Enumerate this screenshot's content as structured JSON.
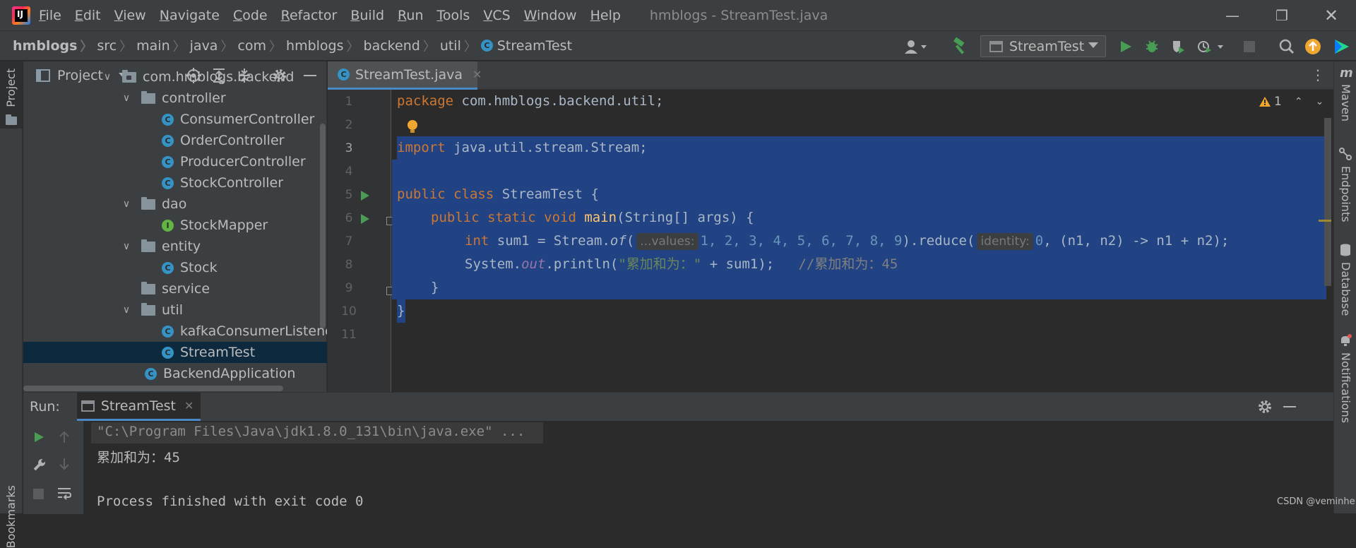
{
  "window": {
    "title": "hmblogs - StreamTest.java",
    "logo_text": "IJ"
  },
  "menu": [
    "File",
    "Edit",
    "View",
    "Navigate",
    "Code",
    "Refactor",
    "Build",
    "Run",
    "Tools",
    "VCS",
    "Window",
    "Help"
  ],
  "breadcrumb": [
    "hmblogs",
    "src",
    "main",
    "java",
    "com",
    "hmblogs",
    "backend",
    "util",
    "StreamTest"
  ],
  "run_config": {
    "label": "StreamTest"
  },
  "left_strip": {
    "project_tab": "Project",
    "bookmarks_tab": "Bookmarks"
  },
  "right_strip": {
    "maven": "Maven",
    "endpoints": "Endpoints",
    "database": "Database",
    "notifications": "Notifications"
  },
  "project_panel": {
    "title": "Project",
    "tree": [
      {
        "label": "com.hmblogs.backend",
        "type": "package",
        "depth": 0,
        "expanded": true
      },
      {
        "label": "controller",
        "type": "folder",
        "depth": 1,
        "expanded": true
      },
      {
        "label": "ConsumerController",
        "type": "class",
        "depth": 2
      },
      {
        "label": "OrderController",
        "type": "class",
        "depth": 2
      },
      {
        "label": "ProducerController",
        "type": "class",
        "depth": 2
      },
      {
        "label": "StockController",
        "type": "class",
        "depth": 2
      },
      {
        "label": "dao",
        "type": "folder",
        "depth": 1,
        "expanded": true
      },
      {
        "label": "StockMapper",
        "type": "interface",
        "depth": 2
      },
      {
        "label": "entity",
        "type": "folder",
        "depth": 1,
        "expanded": true
      },
      {
        "label": "Stock",
        "type": "class",
        "depth": 2
      },
      {
        "label": "service",
        "type": "folder",
        "depth": 1,
        "expanded": false
      },
      {
        "label": "util",
        "type": "folder",
        "depth": 1,
        "expanded": true
      },
      {
        "label": "kafkaConsumerListenerl",
        "type": "class",
        "depth": 2
      },
      {
        "label": "StreamTest",
        "type": "class",
        "depth": 2,
        "selected": true
      },
      {
        "label": "BackendApplication",
        "type": "class",
        "depth": 1
      }
    ]
  },
  "editor": {
    "tab_label": "StreamTest.java",
    "warning_count": "1",
    "line_numbers": [
      "1",
      "2",
      "3",
      "4",
      "5",
      "6",
      "7",
      "8",
      "9",
      "10",
      "11"
    ],
    "code": {
      "l1_kw": "package",
      "l1_rest": " com.hmblogs.backend.util;",
      "l3_kw": "import",
      "l3_rest": " java.util.stream.Stream;",
      "l5_kw": "public class",
      "l5_rest": " StreamTest {",
      "l6_kw": "public static void",
      "l6_fn": "main",
      "l6_rest": "(String[] args) {",
      "l7_kw": "int",
      "l7_a": " sum1 = Stream.",
      "l7_of": "of",
      "l7_hint1": "...values:",
      "l7_nums": "1, 2, 3, 4, 5, 6, 7, 8, 9",
      "l7_b": ").reduce(",
      "l7_hint2": "identity:",
      "l7_zero": "0",
      "l7_c": ", (n1, n2) -> n1 + n2);",
      "l8_a": "System.",
      "l8_out": "out",
      "l8_b": ".println(",
      "l8_str": "\"累加和为：\"",
      "l8_c": " + sum1);",
      "l8_cmt": "//累加和为：45",
      "l9": "}",
      "l10": "}"
    }
  },
  "run_panel": {
    "label": "Run:",
    "tab_label": "StreamTest",
    "console": [
      "\"C:\\Program Files\\Java\\jdk1.8.0_131\\bin\\java.exe\" ...",
      "累加和为：45",
      "",
      "Process finished with exit code 0"
    ]
  },
  "watermark": "CSDN @veminhe",
  "colors": {
    "accent": "#4a88c7",
    "selection": "#214283",
    "keyword": "#cc7832",
    "run_green": "#499c54"
  }
}
